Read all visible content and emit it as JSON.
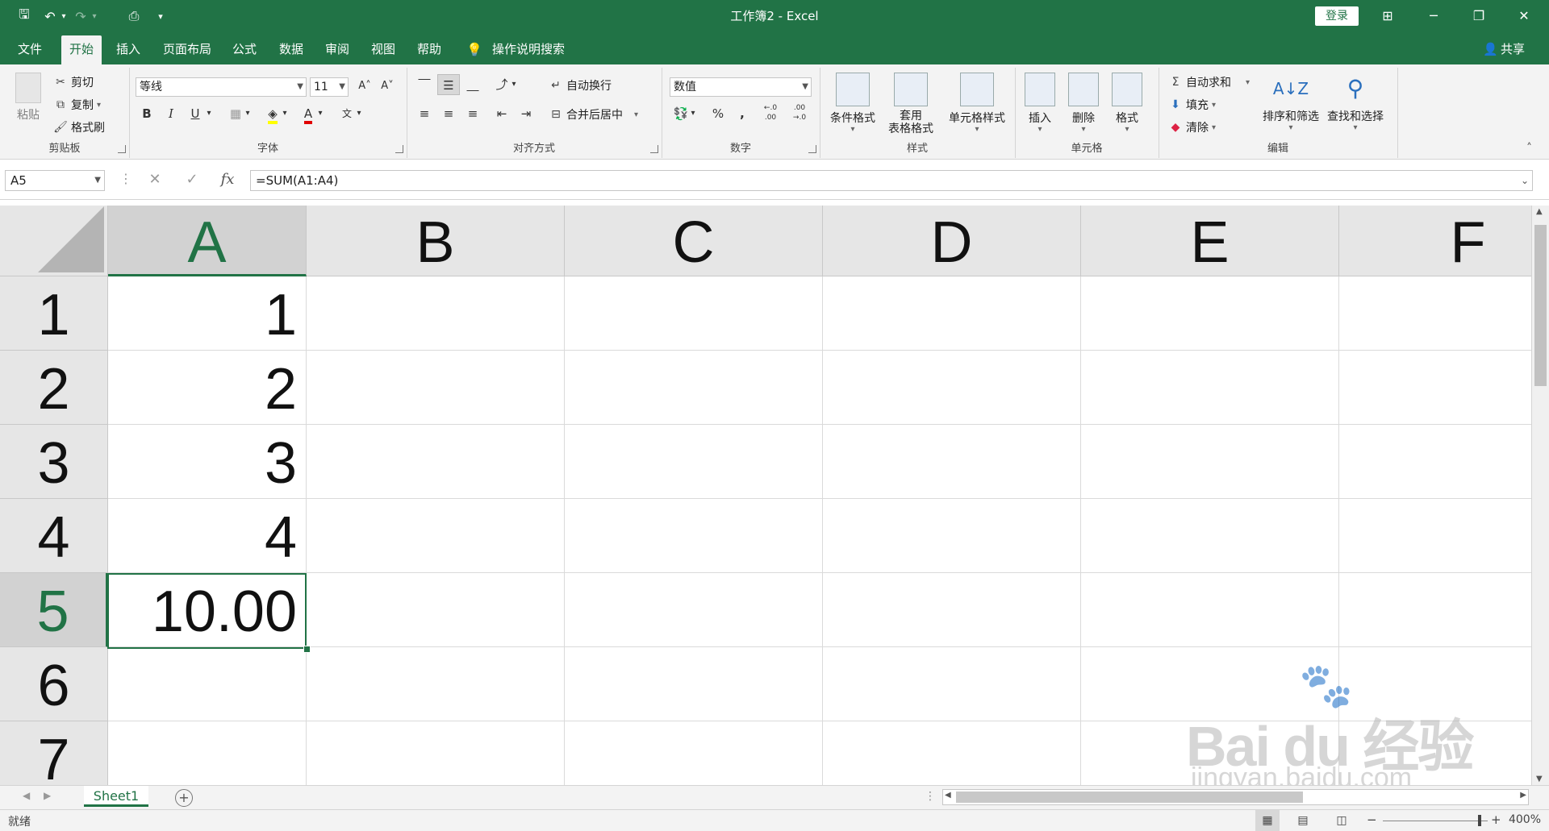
{
  "window": {
    "title": "工作簿2  -  Excel",
    "login_label": "登录",
    "ribbon_display_icon": "⊞",
    "minimize": "─",
    "restore": "❐",
    "close": "✕"
  },
  "quick_access": {
    "save_icon": "🖫",
    "undo_icon": "↶",
    "redo_icon": "↷",
    "print_icon": "⎙",
    "customize_icon": "▾"
  },
  "menu": {
    "tabs": [
      "文件",
      "开始",
      "插入",
      "页面布局",
      "公式",
      "数据",
      "审阅",
      "视图",
      "帮助"
    ],
    "active_tab": "开始",
    "tell_me": "操作说明搜索",
    "share": "共享"
  },
  "ribbon": {
    "clipboard": {
      "label": "剪贴板",
      "paste": "粘贴",
      "cut": "剪切",
      "copy": "复制",
      "format_painter": "格式刷"
    },
    "font": {
      "label": "字体",
      "font_name": "等线",
      "font_size": "11",
      "bold": "B",
      "italic": "I",
      "underline": "U",
      "grow": "A˄",
      "shrink": "A˅",
      "font_color": "A",
      "phonetic": "文"
    },
    "alignment": {
      "label": "对齐方式",
      "wrap_text": "自动换行",
      "merge_center": "合并后居中"
    },
    "number": {
      "label": "数字",
      "format": "数值",
      "percent": "%",
      "comma": ",",
      "inc_decimal": "←.0 .00",
      "dec_decimal": ".00 →.0"
    },
    "styles": {
      "label": "样式",
      "conditional": "条件格式",
      "table_line1": "套用",
      "table_line2": "表格格式",
      "cell_styles": "单元格样式"
    },
    "cells": {
      "label": "单元格",
      "insert": "插入",
      "delete": "删除",
      "format": "格式"
    },
    "editing": {
      "label": "编辑",
      "autosum": "自动求和",
      "fill": "填充",
      "clear": "清除",
      "sort_filter": "排序和筛选",
      "find_select": "查找和选择"
    }
  },
  "formula_bar": {
    "name_box": "A5",
    "cancel_icon": "✕",
    "enter_icon": "✓",
    "fx_icon": "fx",
    "formula": "=SUM(A1:A4)"
  },
  "grid": {
    "columns": [
      "A",
      "B",
      "C",
      "D",
      "E",
      "F"
    ],
    "rows": [
      "1",
      "2",
      "3",
      "4",
      "5",
      "6",
      "7"
    ],
    "selected_column": "A",
    "selected_row": "5",
    "cells": {
      "A1": "1",
      "A2": "2",
      "A3": "3",
      "A4": "4",
      "A5": "10.00"
    }
  },
  "sheets": {
    "tabs": [
      "Sheet1"
    ],
    "add_icon": "+"
  },
  "status": {
    "ready": "就绪",
    "zoom": "400%",
    "zoom_minus": "−",
    "zoom_plus": "+"
  },
  "watermark": {
    "logo": "Bai du 经验",
    "url": "jingyan.baidu.com"
  }
}
